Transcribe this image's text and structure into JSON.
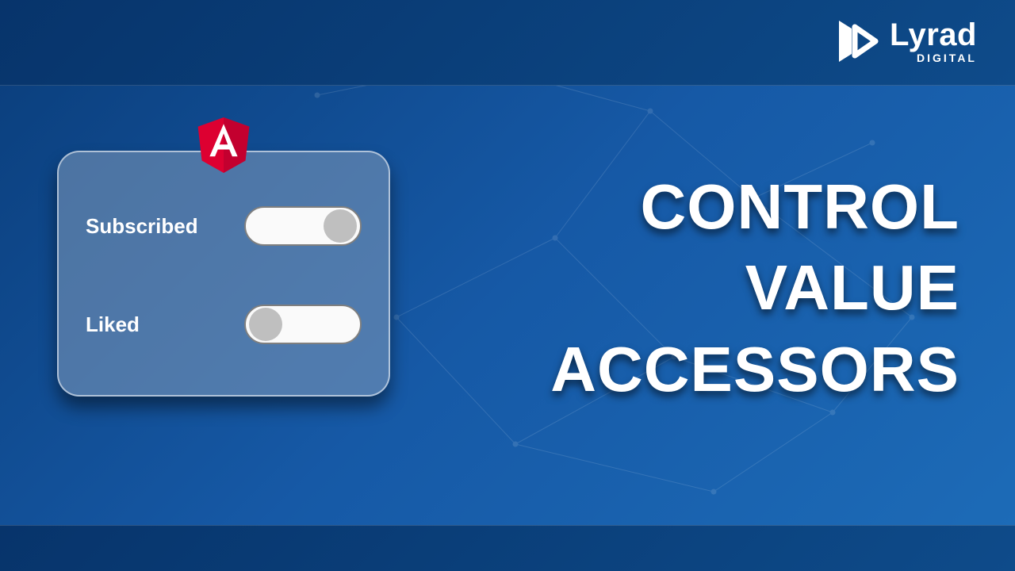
{
  "brand": {
    "name": "Lyrad",
    "sub": "DIGITAL"
  },
  "card": {
    "rows": [
      {
        "label": "Subscribed",
        "on": true
      },
      {
        "label": "Liked",
        "on": false
      }
    ]
  },
  "headline": {
    "l1": "CONTROL",
    "l2": "VALUE",
    "l3": "ACCESSORS"
  }
}
